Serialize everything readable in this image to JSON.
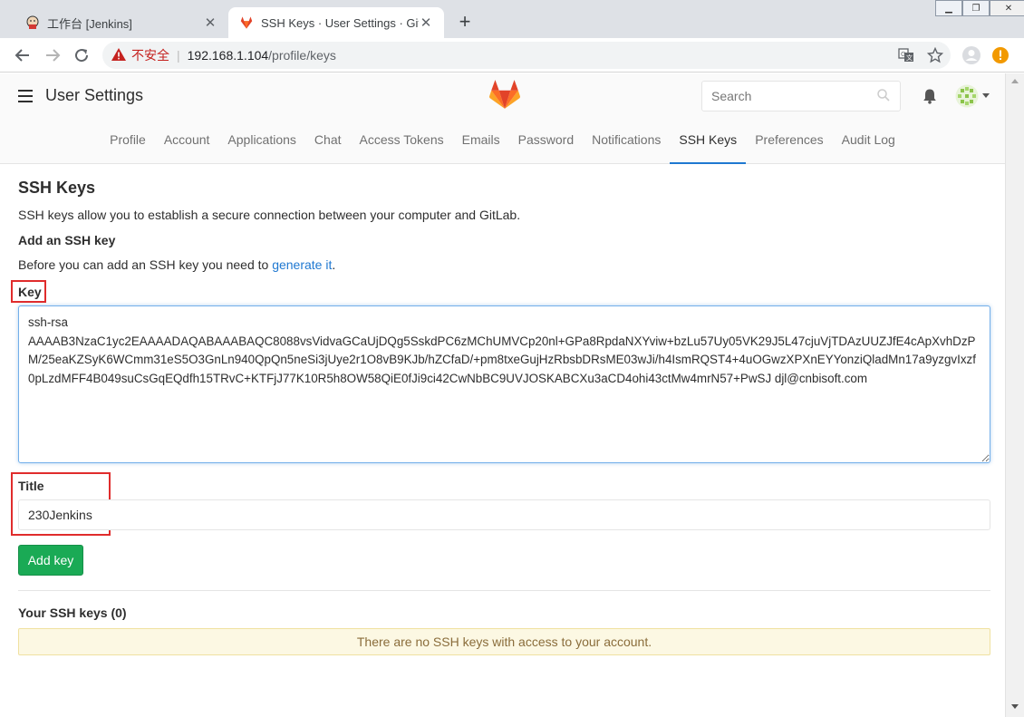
{
  "browser": {
    "tabs": [
      {
        "title": "工作台 [Jenkins]"
      },
      {
        "title": "SSH Keys · User Settings · GitLab"
      }
    ],
    "address": {
      "security_label": "不安全",
      "host": "192.168.1.104",
      "path": "/profile/keys"
    }
  },
  "header": {
    "app_title": "User Settings",
    "search_placeholder": "Search",
    "nav": [
      {
        "label": "Profile"
      },
      {
        "label": "Account"
      },
      {
        "label": "Applications"
      },
      {
        "label": "Chat"
      },
      {
        "label": "Access Tokens"
      },
      {
        "label": "Emails"
      },
      {
        "label": "Password"
      },
      {
        "label": "Notifications"
      },
      {
        "label": "SSH Keys",
        "active": true
      },
      {
        "label": "Preferences"
      },
      {
        "label": "Audit Log"
      }
    ]
  },
  "main": {
    "title": "SSH Keys",
    "description": "SSH keys allow you to establish a secure connection between your computer and GitLab.",
    "add_heading": "Add an SSH key",
    "before_text": "Before you can add an SSH key you need to ",
    "generate_link": "generate it",
    "before_suffix": ".",
    "key_label": "Key",
    "key_value": "ssh-rsa\nAAAAB3NzaC1yc2EAAAADAQABAAABAQC8088vsVidvaGCaUjDQg5SskdPC6zMChUMVCp20nl+GPa8RpdaNXYviw+bzLu57Uy05VK29J5L47cjuVjTDAzUUZJfE4cApXvhDzPM/25eaKZSyK6WCmm31eS5O3GnLn940QpQn5neSi3jUye2r1O8vB9KJb/hZCfaD/+pm8txeGujHzRbsbDRsME03wJi/h4IsmRQST4+4uOGwzXPXnEYYonziQladMn17a9yzgvIxzf0pLzdMFF4B049suCsGqEQdfh15TRvC+KTFjJ77K10R5h8OW58QiE0fJi9ci42CwNbBC9UVJOSKABCXu3aCD4ohi43ctMw4mrN57+PwSJ djl@cnbisoft.com",
    "title_label": "Title",
    "title_value": "230Jenkins",
    "add_button": "Add key",
    "your_keys": "Your SSH keys (0)",
    "empty_message": "There are no SSH keys with access to your account."
  }
}
